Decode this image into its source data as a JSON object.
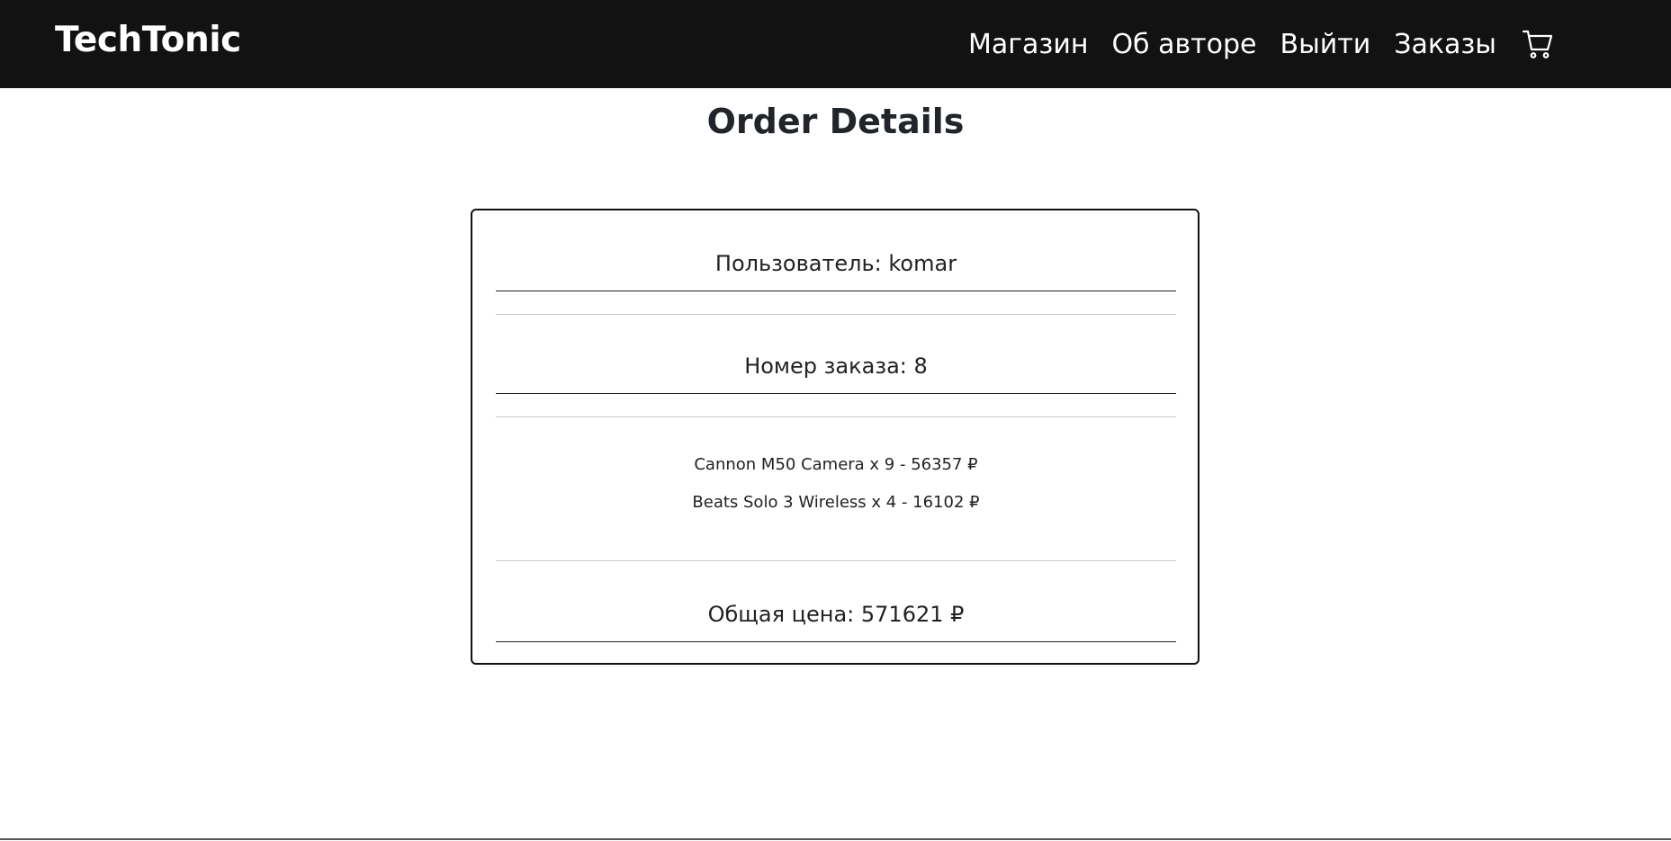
{
  "navbar": {
    "brand": "TechTonic",
    "links": [
      {
        "label": "Магазин"
      },
      {
        "label": "Об авторе"
      },
      {
        "label": "Выйти"
      },
      {
        "label": "Заказы"
      }
    ],
    "cart_icon": "cart-icon"
  },
  "page": {
    "title": "Order Details"
  },
  "order": {
    "user_line": "Пользователь: komar",
    "number_line": "Номер заказа: 8",
    "items": [
      "Cannon M50 Camera x 9 - 56357 ₽",
      "Beats Solo 3 Wireless x 4 - 16102 ₽"
    ],
    "total_line": "Общая цена: 571621 ₽"
  }
}
